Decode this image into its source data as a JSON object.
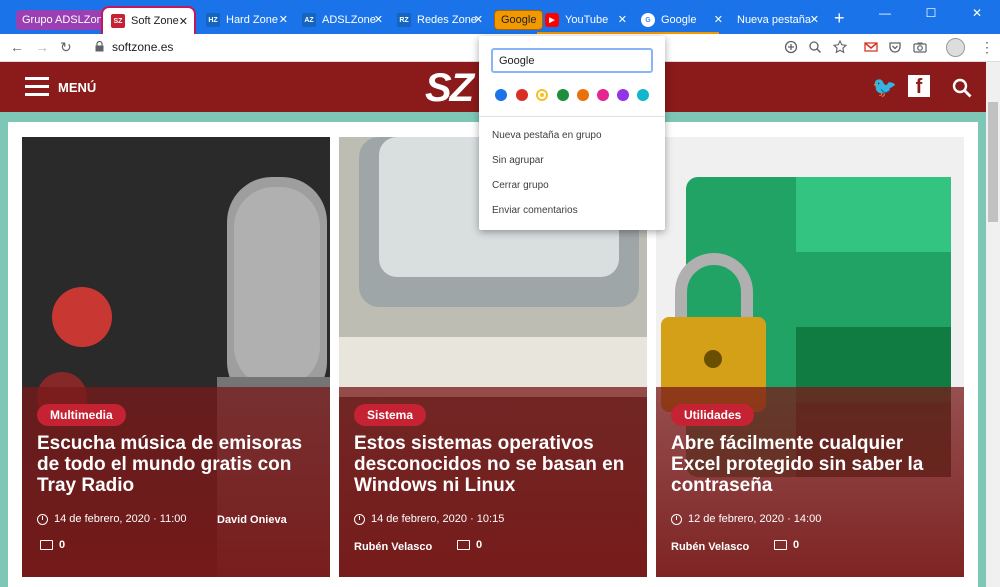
{
  "browser": {
    "groups": [
      {
        "label": "Grupo ADSLZone",
        "color": "#9b3fb5"
      },
      {
        "label": "Google",
        "color": "#f29900"
      }
    ],
    "tabs": [
      {
        "label": "Soft Zone",
        "favicon": "SZ",
        "favicon_color": "#c52233"
      },
      {
        "label": "Hard Zone",
        "favicon": "HZ",
        "favicon_color": "#1565c0"
      },
      {
        "label": "ADSLZone",
        "favicon": "AZ",
        "favicon_color": "#1565c0"
      },
      {
        "label": "Redes Zone",
        "favicon": "RZ",
        "favicon_color": "#1565c0"
      },
      {
        "label": "YouTube",
        "favicon": "youtube-icon",
        "favicon_color": "#ff0000"
      },
      {
        "label": "Google",
        "favicon": "google-icon",
        "favicon_color": "#4285f4"
      },
      {
        "label": "Nueva pestaña",
        "favicon": "",
        "favicon_color": ""
      }
    ],
    "new_tab_symbol": "+",
    "url": "softzone.es"
  },
  "group_menu": {
    "name_value": "Google",
    "colors": [
      "#1a73e8",
      "#d93025",
      "#f6c026",
      "#1e8e3e",
      "#e8710a",
      "#e52592",
      "#9334e6",
      "#12b5cb"
    ],
    "selected_color_index": 2,
    "items": [
      "Nueva pestaña en grupo",
      "Sin agrupar",
      "Cerrar grupo",
      "Enviar comentarios"
    ]
  },
  "site": {
    "menu_label": "MENÚ",
    "logo": "SZ",
    "header_color": "#8b1a1a",
    "accent": "#c52233"
  },
  "articles": [
    {
      "category": "Multimedia",
      "title": "Escucha música de emisoras de todo el mundo gratis con Tray Radio",
      "date": "14 de febrero, 2020 · 11:00",
      "author": "David Onieva",
      "comments": "0"
    },
    {
      "category": "Sistema",
      "title": "Estos sistemas operativos desconocidos no se basan en Windows ni Linux",
      "date": "14 de febrero, 2020 · 10:15",
      "author": "Rubén Velasco",
      "comments": "0"
    },
    {
      "category": "Utilidades",
      "title": "Abre fácilmente cualquier Excel protegido sin saber la contraseña",
      "date": "12 de febrero, 2020 · 14:00",
      "author": "Rubén Velasco",
      "comments": "0"
    }
  ]
}
